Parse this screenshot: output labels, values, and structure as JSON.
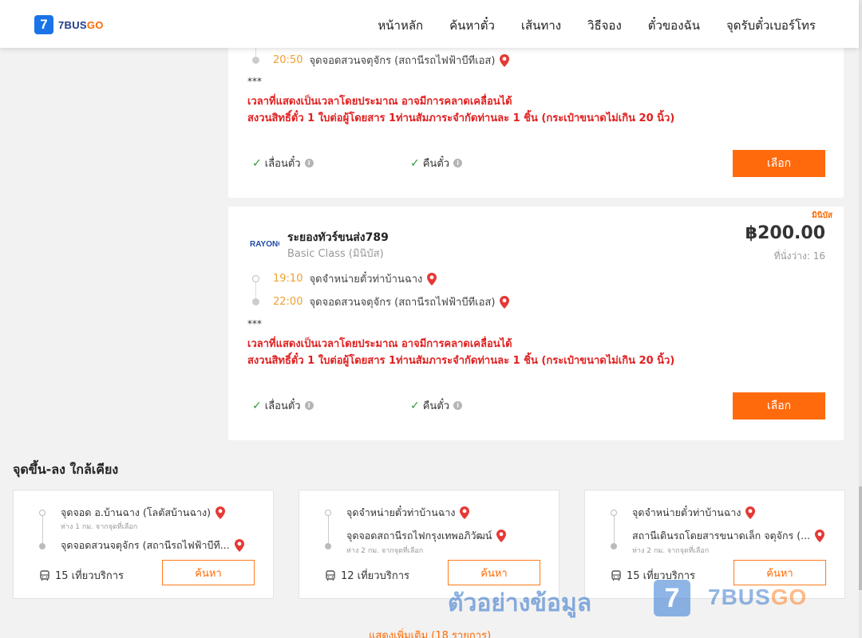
{
  "header": {
    "logo_mark": "7",
    "logo_text_a": "7BUS",
    "logo_text_b": "GO",
    "nav": [
      "หน้าหลัก",
      "ค้นหาตั๋ว",
      "เส้นทาง",
      "วิธีจอง",
      "ตั๋วของฉัน",
      "จุดรับตั๋วเบอร์โทร"
    ]
  },
  "trip1": {
    "arrive_time": "20:50",
    "arrive_stop": "จุดจอดสวนจตุจักร (สถานีรถไฟฟ้าบีทีเอส)",
    "stars": "***",
    "warn1": "เวลาที่แสดงเป็นเวลาโดยประมาณ อาจมีการคลาดเคลื่อนได้",
    "warn2": "สงวนสิทธิ์ตั๋ว 1 ใบต่อผู้โดยสาร 1ท่านสัมภาระจำกัดท่านละ 1 ชิ้น (กระเป๋าขนาดไม่เกิน 20 นิ้ว)",
    "feat_change": "เลื่อนตั๋ว",
    "feat_refund": "คืนตั๋ว",
    "select_label": "เลือก"
  },
  "trip2": {
    "badge": "มินิบัส",
    "operator_logo_text": "RAYONG",
    "operator": "ระยองทัวร์ขนส่ง789",
    "class": "Basic Class (มินิบัส)",
    "price": "฿200.00",
    "seats": "ที่นั่งว่าง: 16",
    "depart_time": "19:10",
    "depart_stop": "จุดจำหน่ายตั๋วท่าบ้านฉาง",
    "arrive_time": "22:00",
    "arrive_stop": "จุดจอดสวนจตุจักร (สถานีรถไฟฟ้าบีทีเอส)",
    "stars": "***",
    "warn1": "เวลาที่แสดงเป็นเวลาโดยประมาณ อาจมีการคลาดเคลื่อนได้",
    "warn2": "สงวนสิทธิ์ตั๋ว 1 ใบต่อผู้โดยสาร 1ท่านสัมภาระจำกัดท่านละ 1 ชิ้น (กระเป๋าขนาดไม่เกิน 20 นิ้ว)",
    "feat_change": "เลื่อนตั๋ว",
    "feat_refund": "คืนตั๋ว",
    "select_label": "เลือก"
  },
  "nearby": {
    "title": "จุดขึ้น-ลง ใกล้เคียง",
    "cards": [
      {
        "from": "จุดจอด อ.บ้านฉาง (โลตัสบ้านฉาง)",
        "from_sub": "ห่าง 1 กม. จากจุดที่เลือก",
        "to": "จุดจอดสวนจตุจักร (สถานีรถไฟฟ้าบีที...",
        "to_sub": "",
        "trips": "15 เที่ยวบริการ",
        "button": "ค้นหา"
      },
      {
        "from": "จุดจำหน่ายตั๋วท่าบ้านฉาง",
        "from_sub": "",
        "to": "จุดจอดสถานีรถไฟกรุงเทพอภิวัฒน์",
        "to_sub": "ห่าง 2 กม. จากจุดที่เลือก",
        "trips": "12 เที่ยวบริการ",
        "button": "ค้นหา"
      },
      {
        "from": "จุดจำหน่ายตั๋วท่าบ้านฉาง",
        "from_sub": "",
        "to": "สถานีเดินรถโดยสารขนาดเล็ก จตุจักร (...",
        "to_sub": "ห่าง 2 กม. จากจุดที่เลือก",
        "trips": "15 เที่ยวบริการ",
        "button": "ค้นหา"
      }
    ],
    "show_more": "แสดงเพิ่มเติม (18 รายการ)"
  },
  "watermark": {
    "text": "ตัวอย่างข้อมูล",
    "mark": "7",
    "brand_a": "7BUS",
    "brand_b": "GO"
  },
  "colors": {
    "accent": "#ff6a0d",
    "warn": "#e02020",
    "time": "#f0a030",
    "check": "#2e9b3a"
  }
}
